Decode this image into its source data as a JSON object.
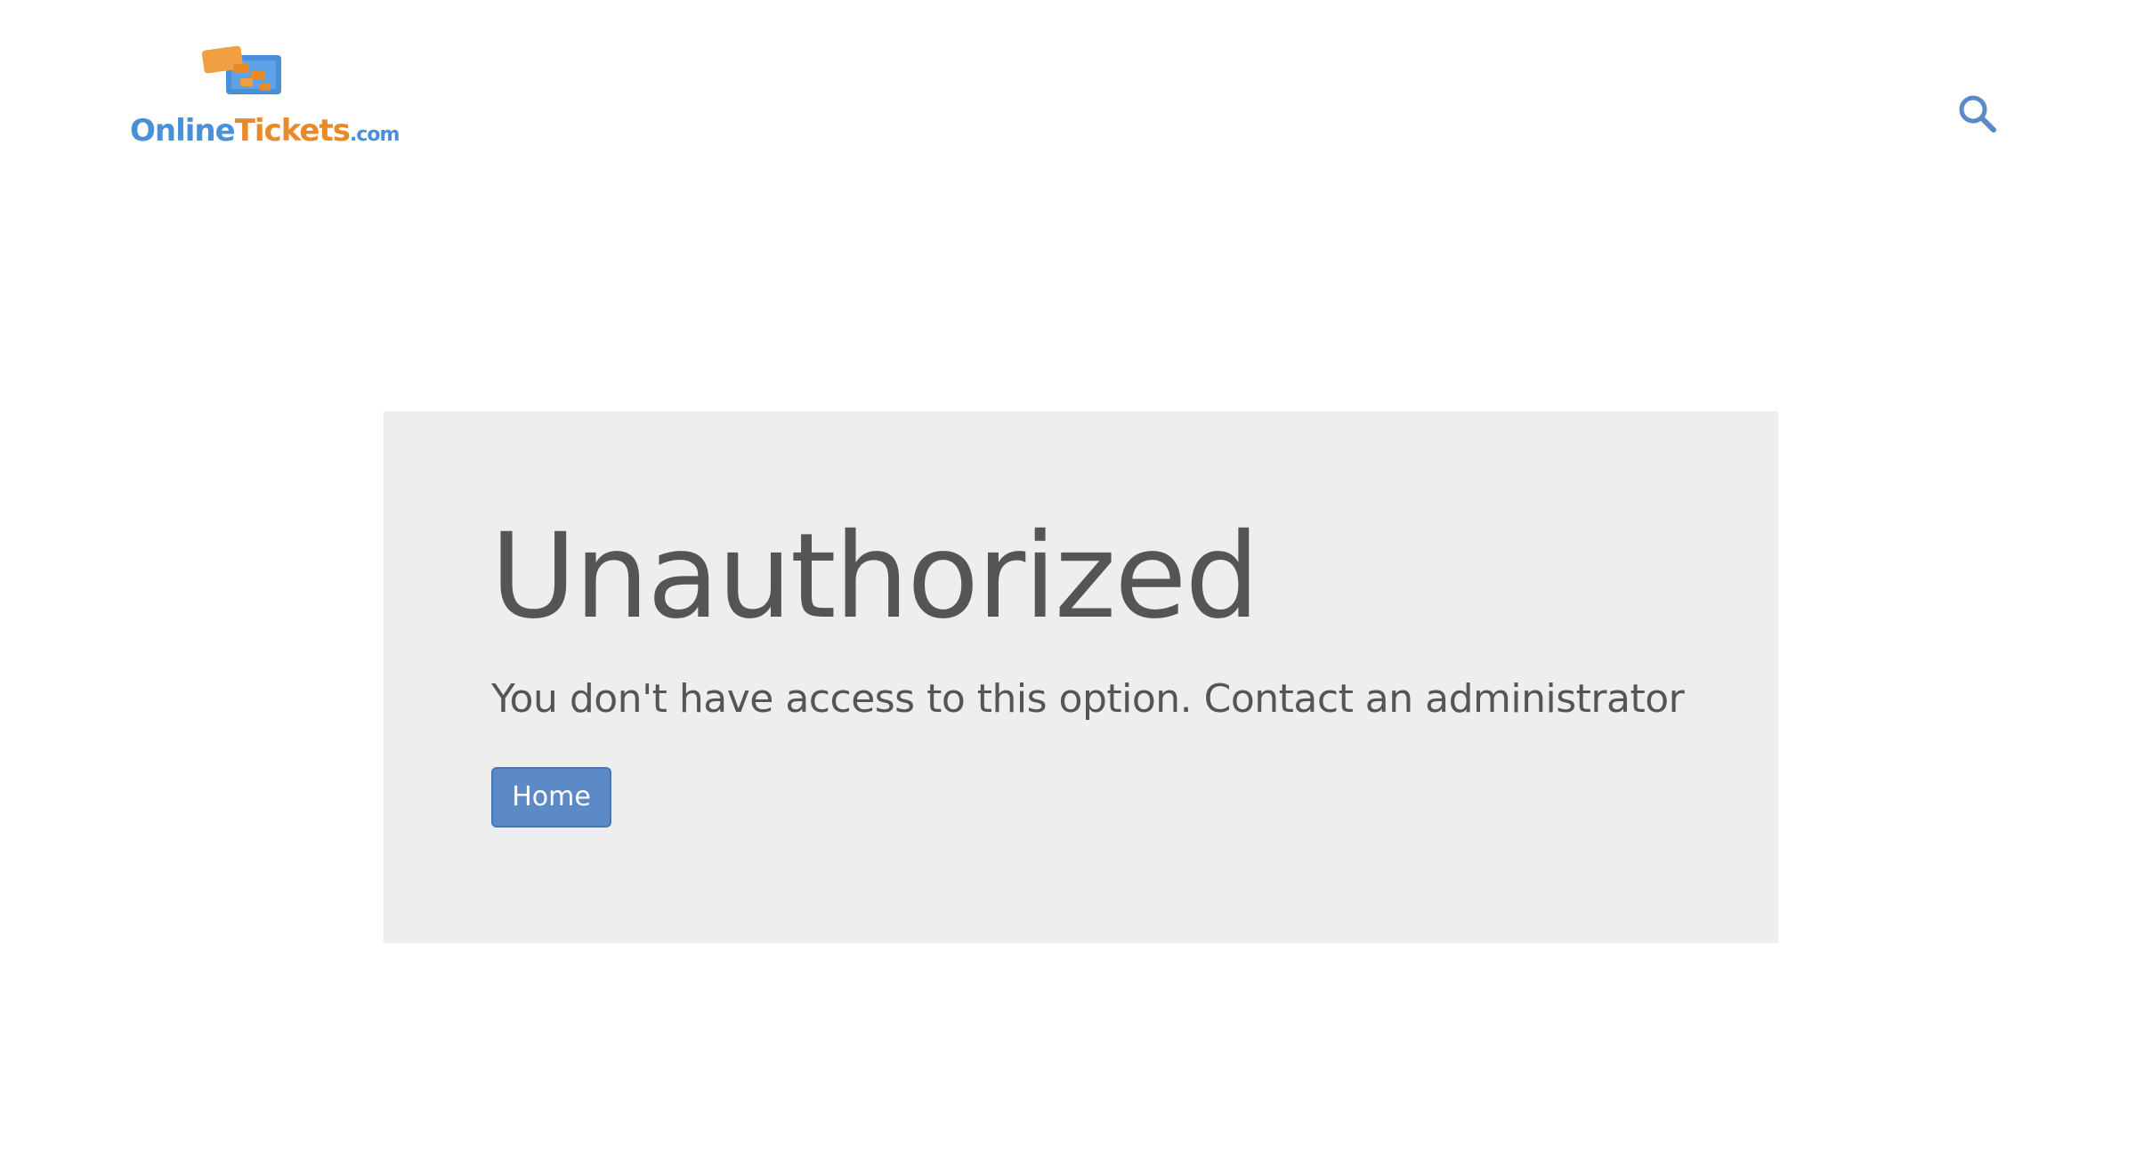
{
  "header": {
    "logo": {
      "text_online": "Online",
      "text_tickets": "Tickets",
      "text_com": ".com",
      "icon": "ticket-stack-icon"
    },
    "search": {
      "icon": "search-icon"
    }
  },
  "main": {
    "title": "Unauthorized",
    "message": "You don't have access to this option. Contact an administrator",
    "home_button_label": "Home"
  },
  "colors": {
    "brand_blue": "#4a90d9",
    "brand_orange": "#e88a2a",
    "button_blue": "#5b8ac7",
    "panel_bg": "#eeeeee",
    "text_gray": "#555555"
  }
}
